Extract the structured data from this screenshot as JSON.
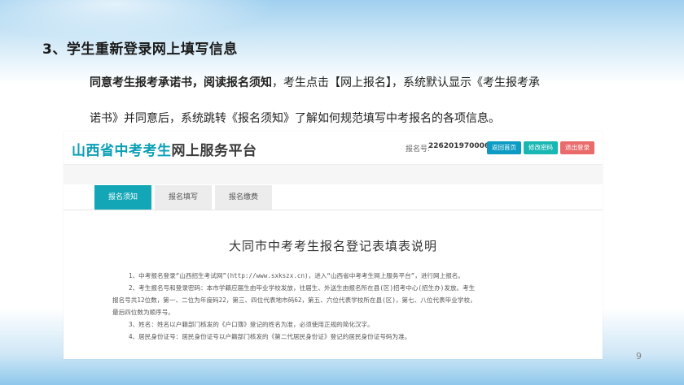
{
  "section": {
    "title": "3、学生重新登录网上填写信息"
  },
  "description": {
    "bold_lead": "同意考生报考承诺书，阅读报名须知",
    "rest_line1": "，考生点击【网上报名】，系统默认显示《考生报考承",
    "line2": "诺书》并同意后，系统跳转《报名须知》了解如何规范填写中考报名的各项信息。"
  },
  "page_number": "9",
  "app": {
    "brand_colored": "山西省中考考生",
    "brand_rest": "网上服务平台",
    "reg_label": "报名号:",
    "reg_number": "226201970006",
    "buttons": {
      "home": "返回首页",
      "change_password": "修改密码",
      "logout": "退出登录"
    },
    "tabs": [
      {
        "label": "报名须知",
        "active": true
      },
      {
        "label": "报名填写",
        "active": false
      },
      {
        "label": "报名缴费",
        "active": false
      }
    ],
    "doc": {
      "title": "大同市中考考生报名登记表填表说明",
      "lines": [
        "1、中考报名登录“山西招生考试网”(http://www.sxkszx.cn)，进入“山西省中考考生网上服务平台”，进行网上报名。",
        "2、考生报名号和登录密码：本市学籍应届生由毕业学校发放，往届生、外送生由报名所在县(区)招考中心(招生办)发放。考生",
        "报名号共12位数，第一、二位为年度码22，第三、四位代表地市码62，第五、六位代表学校所在县(区)，第七、八位代表毕业学校，",
        "最后四位数为顺序号。",
        "3、姓名：姓名以户籍部门核发的《户口簿》登记的姓名为准，必须使用正规的简化汉字。",
        "4、居民身份证号：居民身份证号以户籍部门核发的《第二代居民身份证》登记的居民身份证号码为准。"
      ]
    }
  },
  "colors": {
    "brand_teal": "#0b9fb6",
    "tab_active": "#12a6b6",
    "btn_home": "#0c9bc3",
    "btn_password": "#19b7b3",
    "btn_logout": "#e96b6b"
  }
}
